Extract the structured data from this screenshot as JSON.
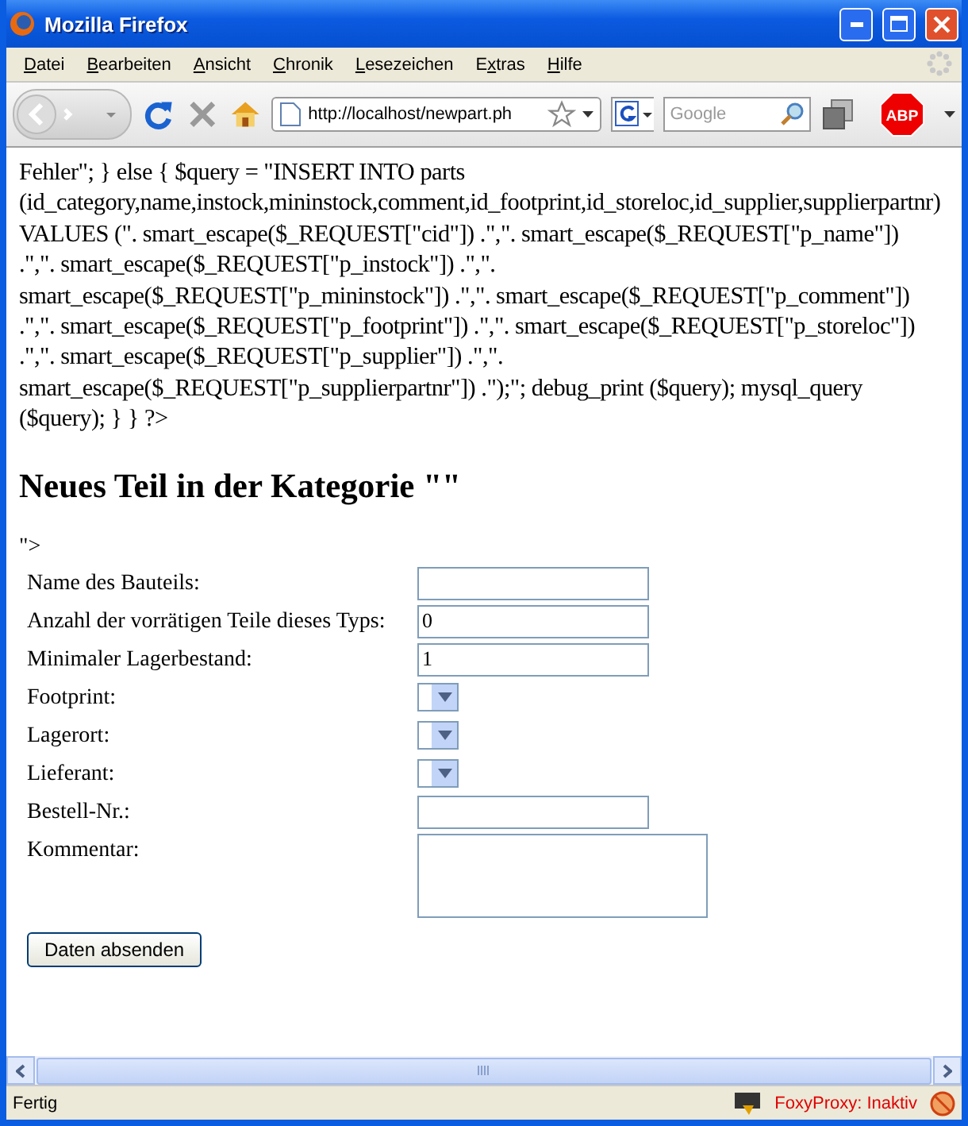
{
  "window": {
    "title": "Mozilla Firefox"
  },
  "menu": [
    {
      "access_key": "D",
      "after": "atei"
    },
    {
      "access_key": "B",
      "after": "earbeiten"
    },
    {
      "access_key": "A",
      "after": "nsicht"
    },
    {
      "access_key": "C",
      "after": "hronik"
    },
    {
      "access_key": "L",
      "after": "esezeichen"
    },
    {
      "before": "E",
      "access_key": "x",
      "after": "tras"
    },
    {
      "access_key": "H",
      "after": "ilfe"
    }
  ],
  "toolbar": {
    "url": "http://localhost/newpart.ph",
    "search_placeholder": "Google",
    "adblock_label": "ABP"
  },
  "page": {
    "code_lines": [
      "Fehler\"; } else { $query = \"INSERT INTO parts",
      "(id_category,name,instock,mininstock,comment,id_footprint,id_storeloc,id_supplier,supplierpartnr)",
      "VALUES (\". smart_escape($_REQUEST[\"cid\"]) .\",\". smart_escape($_REQUEST[\"p_name\"])",
      ".\",\". smart_escape($_REQUEST[\"p_instock\"]) .\",\".",
      "smart_escape($_REQUEST[\"p_mininstock\"]) .\",\". smart_escape($_REQUEST[\"p_comment\"])",
      ".\",\". smart_escape($_REQUEST[\"p_footprint\"]) .\",\". smart_escape($_REQUEST[\"p_storeloc\"])",
      ".\",\". smart_escape($_REQUEST[\"p_supplier\"]) .\",\".",
      "smart_escape($_REQUEST[\"p_supplierpartnr\"]) .\");\"; debug_print ($query); mysql_query",
      "($query); } } ?>"
    ],
    "heading": "Neues Teil in der Kategorie \"\"",
    "stray_text": "\">",
    "form": {
      "fields": [
        {
          "label": "Name des Bauteils:",
          "kind": "text"
        },
        {
          "label": "Anzahl der vorrätigen Teile dieses Typs:",
          "kind": "text",
          "value": "0"
        },
        {
          "label": "Minimaler Lagerbestand:",
          "kind": "text",
          "value": "1"
        },
        {
          "label": "Footprint:",
          "kind": "select"
        },
        {
          "label": "Lagerort:",
          "kind": "select"
        },
        {
          "label": "Lieferant:",
          "kind": "select"
        },
        {
          "label": "Bestell-Nr.:",
          "kind": "text"
        },
        {
          "label": "Kommentar:",
          "kind": "textarea"
        }
      ],
      "submit": "Daten absenden"
    }
  },
  "status_bar": {
    "text": "Fertig",
    "proxy": "FoxyProxy: Inaktiv"
  }
}
